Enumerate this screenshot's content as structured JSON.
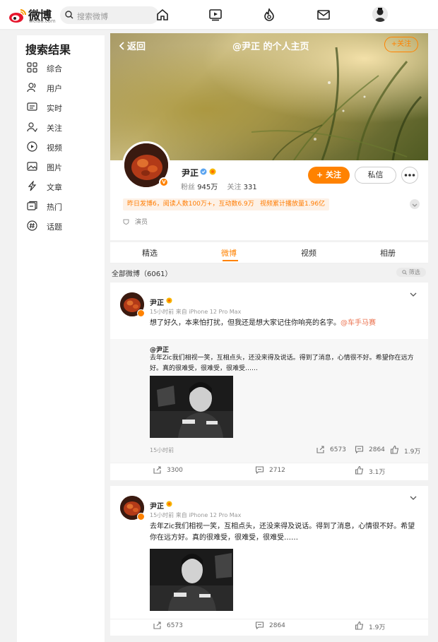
{
  "topbar": {
    "logo_text": "微博",
    "logo_sub": "weibo.com",
    "search_placeholder": "搜索微博"
  },
  "sidebar": {
    "title": "搜索结果",
    "items": [
      {
        "label": "综合",
        "icon": "grid-icon"
      },
      {
        "label": "用户",
        "icon": "users-icon"
      },
      {
        "label": "实时",
        "icon": "realtime-icon"
      },
      {
        "label": "关注",
        "icon": "follow-icon"
      },
      {
        "label": "视频",
        "icon": "video-icon"
      },
      {
        "label": "图片",
        "icon": "image-icon"
      },
      {
        "label": "文章",
        "icon": "article-icon"
      },
      {
        "label": "热门",
        "icon": "hot-icon"
      },
      {
        "label": "话题",
        "icon": "topic-icon"
      }
    ]
  },
  "banner": {
    "back_label": "返回",
    "title": "@尹正 的个人主页",
    "follow_label": "+关注"
  },
  "profile": {
    "name": "尹正",
    "fans_label": "粉丝",
    "fans_value": "945万",
    "following_label": "关注",
    "following_value": "331",
    "follow_button": "+ 关注",
    "message_button": "私信",
    "tag1": "昨日发博6，阅读人数100万+，互动数6.9万",
    "tag2": "视频累计播放量1.96亿",
    "occupation": "演员"
  },
  "tabs": [
    {
      "label": "精选",
      "active": false
    },
    {
      "label": "微博",
      "active": true
    },
    {
      "label": "视频",
      "active": false
    },
    {
      "label": "相册",
      "active": false
    }
  ],
  "filter": {
    "all_label": "全部微博（6061）",
    "filter_button": "筛选"
  },
  "posts": [
    {
      "author": "尹正",
      "meta": "15小时前  来自 iPhone 12 Pro Max",
      "text": "想了好久，本来怕打扰，但我还是想大家记住你响亮的名字。",
      "mention": "@车手马赛",
      "repost": {
        "author": "@尹正",
        "text": "去年Zic我们相视一笑，互相点头，还没来得及说话。得到了消息，心情很不好。希望你在远方好。真的很难受，很难受，很难受……",
        "time": "15小时前",
        "reposts": "6573",
        "comments": "2864",
        "likes": "1.9万"
      },
      "reposts": "3300",
      "comments": "2712",
      "likes": "3.1万"
    },
    {
      "author": "尹正",
      "meta": "15小时前  来自 iPhone 12 Pro Max",
      "text": "去年Zic我们相视一笑，互相点头，还没来得及说话。得到了消息，心情很不好。希望你在远方好。真的很难受，很难受，很难受……",
      "reposts": "6573",
      "comments": "2864",
      "likes": "1.9万"
    }
  ],
  "colors": {
    "accent": "#ff8200",
    "link": "#eb7350",
    "background": "#f2f2f2"
  }
}
